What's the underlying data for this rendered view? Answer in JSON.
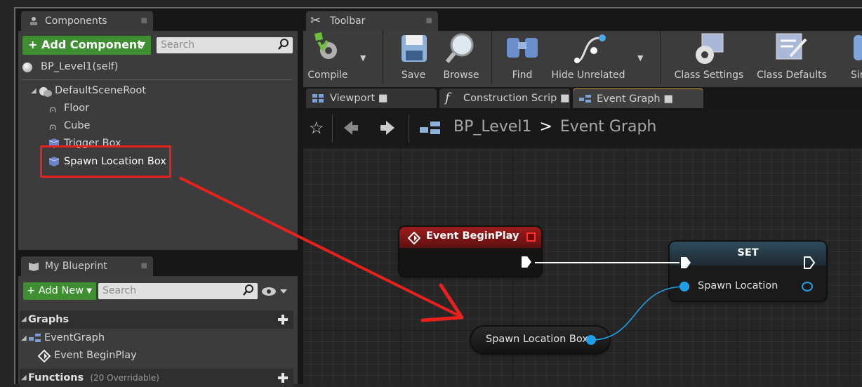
{
  "components": {
    "tab_title": "Components",
    "add_button": "+ Add Component",
    "search_placeholder": "Search",
    "self_item": "BP_Level1(self)",
    "root": "DefaultSceneRoot",
    "items": [
      "Floor",
      "Cube",
      "Trigger Box",
      "Spawn Location Box"
    ]
  },
  "my_blueprint": {
    "tab_title": "My Blueprint",
    "add_button": "+ Add New",
    "search_placeholder": "Search",
    "graphs_label": "Graphs",
    "event_graph": "EventGraph",
    "event_begin_play": "Event BeginPlay",
    "functions_label": "Functions",
    "functions_count": "(20 Overridable)"
  },
  "toolbar": {
    "tab_title": "Toolbar",
    "buttons": [
      "Compile",
      "Save",
      "Browse",
      "Find",
      "Hide Unrelated",
      "Class Settings",
      "Class Defaults",
      "Simu"
    ]
  },
  "graph_tabs": [
    "Viewport",
    "Construction Scrip",
    "Event Graph"
  ],
  "breadcrumb": {
    "blueprint": "BP_Level1",
    "separator": ">",
    "graph": "Event Graph"
  },
  "nodes": {
    "begin_play_title": "Event BeginPlay",
    "set_title": "SET",
    "set_pin": "Spawn Location",
    "var_node": "Spawn Location Box"
  },
  "colors": {
    "accent_red": "#e8211c",
    "pin_blue": "#1e9fe8",
    "green": "#3f8f32"
  }
}
